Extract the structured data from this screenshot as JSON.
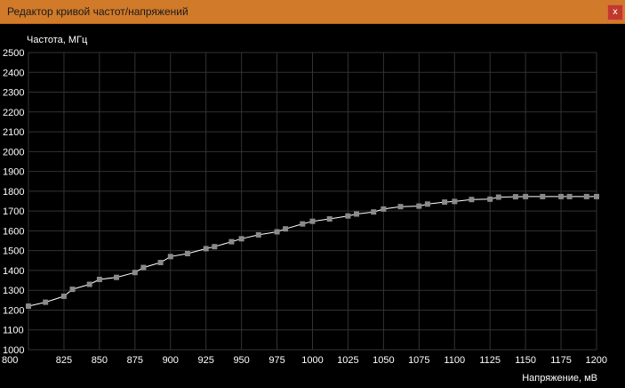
{
  "window": {
    "title": "Редактор кривой частот/напряжений",
    "close_label": "x"
  },
  "colors": {
    "titlebar": "#d07a2a",
    "background": "#000000",
    "grid": "#333333",
    "axis_text": "#ffffff",
    "curve": "#ffffff",
    "marker": "#8a8a8a"
  },
  "chart_data": {
    "type": "line",
    "title": "",
    "ylabel": "Частота, МГц",
    "xlabel": "Напряжение, мВ",
    "xlim": [
      800,
      1200
    ],
    "ylim": [
      1000,
      2500
    ],
    "grid": true,
    "x_ticks": [
      "800",
      "825",
      "850",
      "875",
      "900",
      "925",
      "950",
      "975",
      "1000",
      "1025",
      "1050",
      "1075",
      "1100",
      "1125",
      "1150",
      "1175",
      "1200"
    ],
    "y_ticks": [
      "1000",
      "1100",
      "1200",
      "1300",
      "1400",
      "1500",
      "1600",
      "1700",
      "1800",
      "1900",
      "2000",
      "2100",
      "2200",
      "2300",
      "2400",
      "2500"
    ],
    "series": [
      {
        "x": [
          800,
          812,
          825,
          831,
          843,
          850,
          862,
          875,
          881,
          893,
          900,
          912,
          925,
          931,
          943,
          950,
          962,
          975,
          981,
          993,
          1000,
          1012,
          1025,
          1031,
          1043,
          1050,
          1062,
          1075,
          1081,
          1093,
          1100,
          1112,
          1125,
          1131,
          1143,
          1150,
          1162,
          1175,
          1181,
          1193,
          1200
        ],
        "y": [
          1220,
          1240,
          1270,
          1305,
          1330,
          1355,
          1365,
          1390,
          1415,
          1440,
          1470,
          1485,
          1510,
          1520,
          1545,
          1560,
          1580,
          1595,
          1610,
          1635,
          1648,
          1660,
          1675,
          1685,
          1695,
          1710,
          1722,
          1725,
          1735,
          1745,
          1748,
          1758,
          1760,
          1770,
          1772,
          1773,
          1773,
          1773,
          1773,
          1773,
          1773
        ]
      }
    ]
  }
}
